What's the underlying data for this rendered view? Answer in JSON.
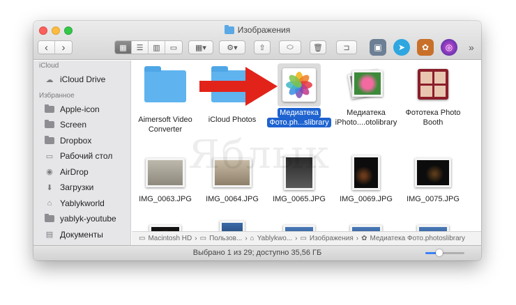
{
  "window": {
    "title": "Изображения"
  },
  "toolbar": {
    "nav_back": "‹",
    "nav_forward": "›",
    "more": "»",
    "apps": [
      {
        "name": "preview-app-icon",
        "color": "#6c7f94"
      },
      {
        "name": "telegram-app-icon",
        "color": "#2ea6e0"
      },
      {
        "name": "image-app-icon",
        "color": "#c8702a"
      },
      {
        "name": "siri-app-icon",
        "color": "#5b3fa8"
      }
    ]
  },
  "sidebar": {
    "sections": [
      {
        "header": "iCloud",
        "items": [
          {
            "label": "iCloud Drive",
            "icon": "cloud-icon"
          }
        ]
      },
      {
        "header": "Избранное",
        "items": [
          {
            "label": "Apple-icon",
            "icon": "folder-icon"
          },
          {
            "label": "Screen",
            "icon": "folder-icon"
          },
          {
            "label": "Dropbox",
            "icon": "folder-icon"
          },
          {
            "label": "Рабочий стол",
            "icon": "desktop-icon"
          },
          {
            "label": "AirDrop",
            "icon": "airdrop-icon"
          },
          {
            "label": "Загрузки",
            "icon": "downloads-icon"
          },
          {
            "label": "Yablykworld",
            "icon": "home-icon"
          },
          {
            "label": "yablyk-youtube",
            "icon": "folder-icon"
          },
          {
            "label": "Документы",
            "icon": "documents-icon"
          }
        ]
      }
    ]
  },
  "files": [
    {
      "line1": "Aimersoft Video",
      "line2": "Converter",
      "kind": "folder"
    },
    {
      "line1": "iCloud Photos",
      "line2": "",
      "kind": "folder"
    },
    {
      "line1": "Медиатека",
      "line2": "Фото.ph...slibrary",
      "kind": "photos-library",
      "selected": true
    },
    {
      "line1": "Медиатека",
      "line2": "iPhoto....otolibrary",
      "kind": "iphoto-library"
    },
    {
      "line1": "Фототека Photo",
      "line2": "Booth",
      "kind": "photobooth-library"
    },
    {
      "line1": "IMG_0063.JPG",
      "line2": "",
      "kind": "photo-paper"
    },
    {
      "line1": "IMG_0064.JPG",
      "line2": "",
      "kind": "photo-paper"
    },
    {
      "line1": "IMG_0065.JPG",
      "line2": "",
      "kind": "photo-device"
    },
    {
      "line1": "IMG_0069.JPG",
      "line2": "",
      "kind": "photo-dark"
    },
    {
      "line1": "IMG_0075.JPG",
      "line2": "",
      "kind": "photo-dark"
    }
  ],
  "path": [
    "Macintosh HD",
    "Пользов...",
    "Yablykwo...",
    "Изображения",
    "Медиатека Фото.photoslibrary"
  ],
  "status": {
    "text": "Выбрано 1 из 29; доступно 35,56 ГБ",
    "zoom": 0.35
  },
  "watermark": "Яблык",
  "colors": {
    "selection": "#1e63d0",
    "arrow": "#e2231a",
    "folder": "#5fb3ee"
  }
}
